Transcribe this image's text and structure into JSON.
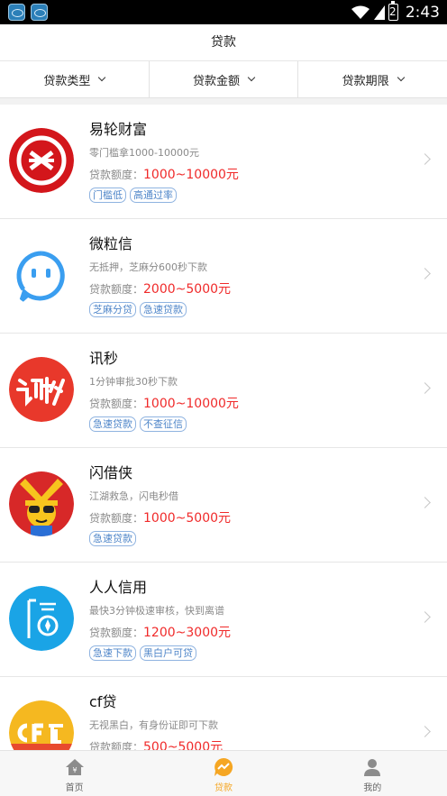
{
  "status_bar": {
    "time": "2:43",
    "battery": "2"
  },
  "header": {
    "title": "贷款"
  },
  "filters": [
    {
      "label": "贷款类型"
    },
    {
      "label": "贷款金额"
    },
    {
      "label": "贷款期限"
    }
  ],
  "loans": [
    {
      "name": "易轮财富",
      "desc": "零门槛拿1000-10000元",
      "amount_label": "贷款额度：",
      "amount": "1000~10000元",
      "tags": [
        "门槛低",
        "高通过率"
      ],
      "logo_icon": "yilun-logo-icon",
      "logo_color": "#d3161b"
    },
    {
      "name": "微粒信",
      "desc": "无抵押，芝麻分600秒下款",
      "amount_label": "贷款额度：",
      "amount": "2000~5000元",
      "tags": [
        "芝麻分贷",
        "急速贷款"
      ],
      "logo_icon": "weilixin-logo-icon",
      "logo_color": "#3a9ef0"
    },
    {
      "name": "讯秒",
      "desc": "1分钟审批30秒下款",
      "amount_label": "贷款额度：",
      "amount": "1000~10000元",
      "tags": [
        "急速贷款",
        "不查征信"
      ],
      "logo_icon": "xunmiao-logo-icon",
      "logo_color": "#e8382b"
    },
    {
      "name": "闪借侠",
      "desc": "江湖救急，闪电秒借",
      "amount_label": "贷款额度：",
      "amount": "1000~5000元",
      "tags": [
        "急速贷款"
      ],
      "logo_icon": "shanjiexia-logo-icon",
      "logo_color": "#d72828"
    },
    {
      "name": "人人信用",
      "desc": "最快3分钟极速审核，快到离谱",
      "amount_label": "贷款额度：",
      "amount": "1200~3000元",
      "tags": [
        "急速下款",
        "黑白户可贷"
      ],
      "logo_icon": "renrenxinyong-logo-icon",
      "logo_color": "#1aa4e6"
    },
    {
      "name": "cf贷",
      "desc": "无视黑白，有身份证即可下款",
      "amount_label": "贷款额度：",
      "amount": "500~5000元",
      "tags": [],
      "logo_icon": "cfdai-logo-icon",
      "logo_color": "#f5b820"
    }
  ],
  "tabs": [
    {
      "label": "首页",
      "icon": "home-icon",
      "active": false
    },
    {
      "label": "贷款",
      "icon": "loan-icon",
      "active": true
    },
    {
      "label": "我的",
      "icon": "profile-icon",
      "active": false
    }
  ],
  "colors": {
    "accent": "#f5a623",
    "amount": "#f02a2a",
    "tag": "#4f86c9"
  }
}
